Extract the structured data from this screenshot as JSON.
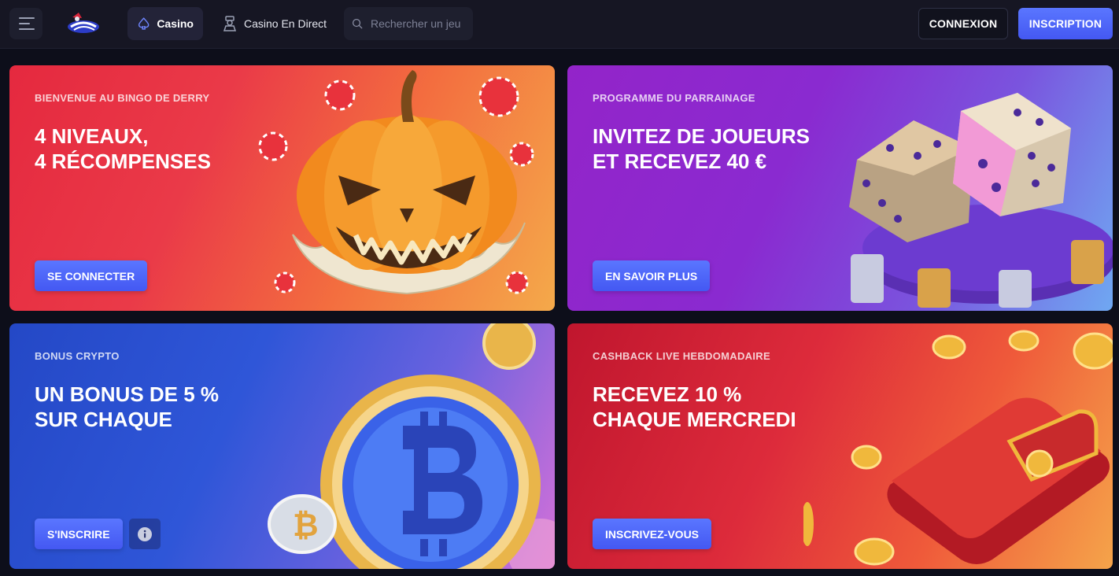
{
  "header": {
    "nav": {
      "casino_label": "Casino",
      "live_label": "Casino En Direct"
    },
    "search": {
      "placeholder": "Rechercher un jeu"
    },
    "login_label": "CONNEXION",
    "register_label": "INSCRIPTION"
  },
  "banners": [
    {
      "subtitle": "BIENVENUE AU BINGO DE DERRY",
      "title_line1": "4 NIVEAUX,",
      "title_line2": "4 RÉCOMPENSES",
      "cta": "SE CONNECTER"
    },
    {
      "subtitle": "PROGRAMME DU PARRAINAGE",
      "title_line1": "INVITEZ DE JOUEURS",
      "title_line2": "ET RECEVEZ 40 €",
      "cta": "EN SAVOIR PLUS"
    },
    {
      "subtitle": "BONUS CRYPTO",
      "title_line1": "UN BONUS DE 5 %",
      "title_line2": "SUR CHAQUE",
      "cta": "S'INSCRIRE"
    },
    {
      "subtitle": "CASHBACK LIVE HEBDOMADAIRE",
      "title_line1": "RECEVEZ 10 %",
      "title_line2": "CHAQUE MERCREDI",
      "cta": "INSCRIVEZ-VOUS"
    }
  ],
  "colors": {
    "accent": "#4f68fb",
    "header_bg": "#161623",
    "page_bg": "#0d0e1a"
  },
  "icons": [
    "menu-icon",
    "spade-icon",
    "dealer-icon",
    "search-icon",
    "info-icon"
  ]
}
